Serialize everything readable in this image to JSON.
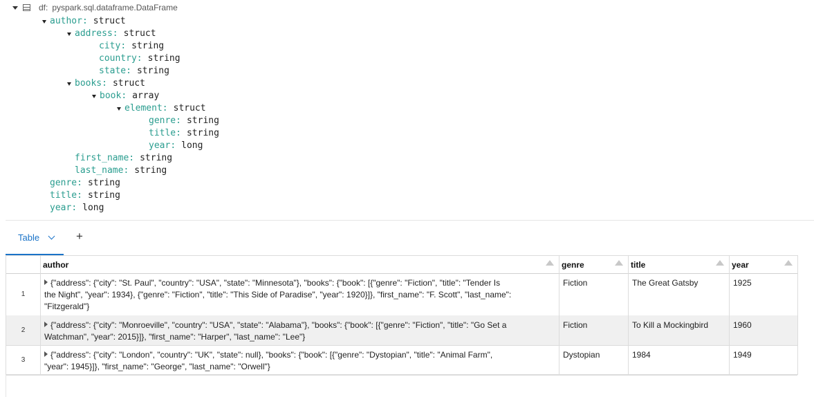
{
  "schema": {
    "var_name": "df:",
    "var_type": "pyspark.sql.dataframe.DataFrame",
    "fields": [
      {
        "name": "author",
        "type": "struct",
        "depth": 0,
        "expandable": true
      },
      {
        "name": "address",
        "type": "struct",
        "depth": 1,
        "expandable": true
      },
      {
        "name": "city",
        "type": "string",
        "depth": 2,
        "expandable": false
      },
      {
        "name": "country",
        "type": "string",
        "depth": 2,
        "expandable": false
      },
      {
        "name": "state",
        "type": "string",
        "depth": 2,
        "expandable": false
      },
      {
        "name": "books",
        "type": "struct",
        "depth": 1,
        "expandable": true
      },
      {
        "name": "book",
        "type": "array",
        "depth": 2,
        "expandable": true
      },
      {
        "name": "element",
        "type": "struct",
        "depth": 3,
        "expandable": true
      },
      {
        "name": "genre",
        "type": "string",
        "depth": 4,
        "expandable": false
      },
      {
        "name": "title",
        "type": "string",
        "depth": 4,
        "expandable": false
      },
      {
        "name": "year",
        "type": "long",
        "depth": 4,
        "expandable": false
      },
      {
        "name": "first_name",
        "type": "string",
        "depth": 1,
        "expandable": false
      },
      {
        "name": "last_name",
        "type": "string",
        "depth": 1,
        "expandable": false
      },
      {
        "name": "genre",
        "type": "string",
        "depth": 0,
        "expandable": false
      },
      {
        "name": "title",
        "type": "string",
        "depth": 0,
        "expandable": false
      },
      {
        "name": "year",
        "type": "long",
        "depth": 0,
        "expandable": false
      }
    ]
  },
  "tabs": {
    "active": "Table",
    "add_label": "+"
  },
  "table": {
    "columns": [
      "author",
      "genre",
      "title",
      "year"
    ],
    "rows": [
      {
        "index": "1",
        "author_lines": [
          "{\"address\": {\"city\": \"St. Paul\", \"country\": \"USA\", \"state\": \"Minnesota\"}, \"books\": {\"book\": [{\"genre\": \"Fiction\", \"title\": \"Tender Is",
          "the Night\", \"year\": 1934}, {\"genre\": \"Fiction\", \"title\": \"This Side of Paradise\", \"year\": 1920}]}, \"first_name\": \"F. Scott\", \"last_name\":",
          "\"Fitzgerald\"}"
        ],
        "genre": "Fiction",
        "title": "The Great Gatsby",
        "year": "1925"
      },
      {
        "index": "2",
        "author_lines": [
          "{\"address\": {\"city\": \"Monroeville\", \"country\": \"USA\", \"state\": \"Alabama\"}, \"books\": {\"book\": [{\"genre\": \"Fiction\", \"title\": \"Go Set a",
          "Watchman\", \"year\": 2015}]}, \"first_name\": \"Harper\", \"last_name\": \"Lee\"}"
        ],
        "genre": "Fiction",
        "title": "To Kill a Mockingbird",
        "year": "1960"
      },
      {
        "index": "3",
        "author_lines": [
          "{\"address\": {\"city\": \"London\", \"country\": \"UK\", \"state\": null}, \"books\": {\"book\": [{\"genre\": \"Dystopian\", \"title\": \"Animal Farm\",",
          "\"year\": 1945}]}, \"first_name\": \"George\", \"last_name\": \"Orwell\"}"
        ],
        "genre": "Dystopian",
        "title": "1984",
        "year": "1949"
      }
    ]
  },
  "colors": {
    "field_name": "#2a9d8f",
    "accent": "#1a73c8",
    "alt_row": "#f0f0f0"
  },
  "icons": {
    "dataframe": "table-icon",
    "collapse": "caret-down-icon",
    "expand_row": "caret-right-icon",
    "sort": "sort-up-icon",
    "tab_menu": "chevron-down-icon",
    "add": "plus-icon"
  }
}
